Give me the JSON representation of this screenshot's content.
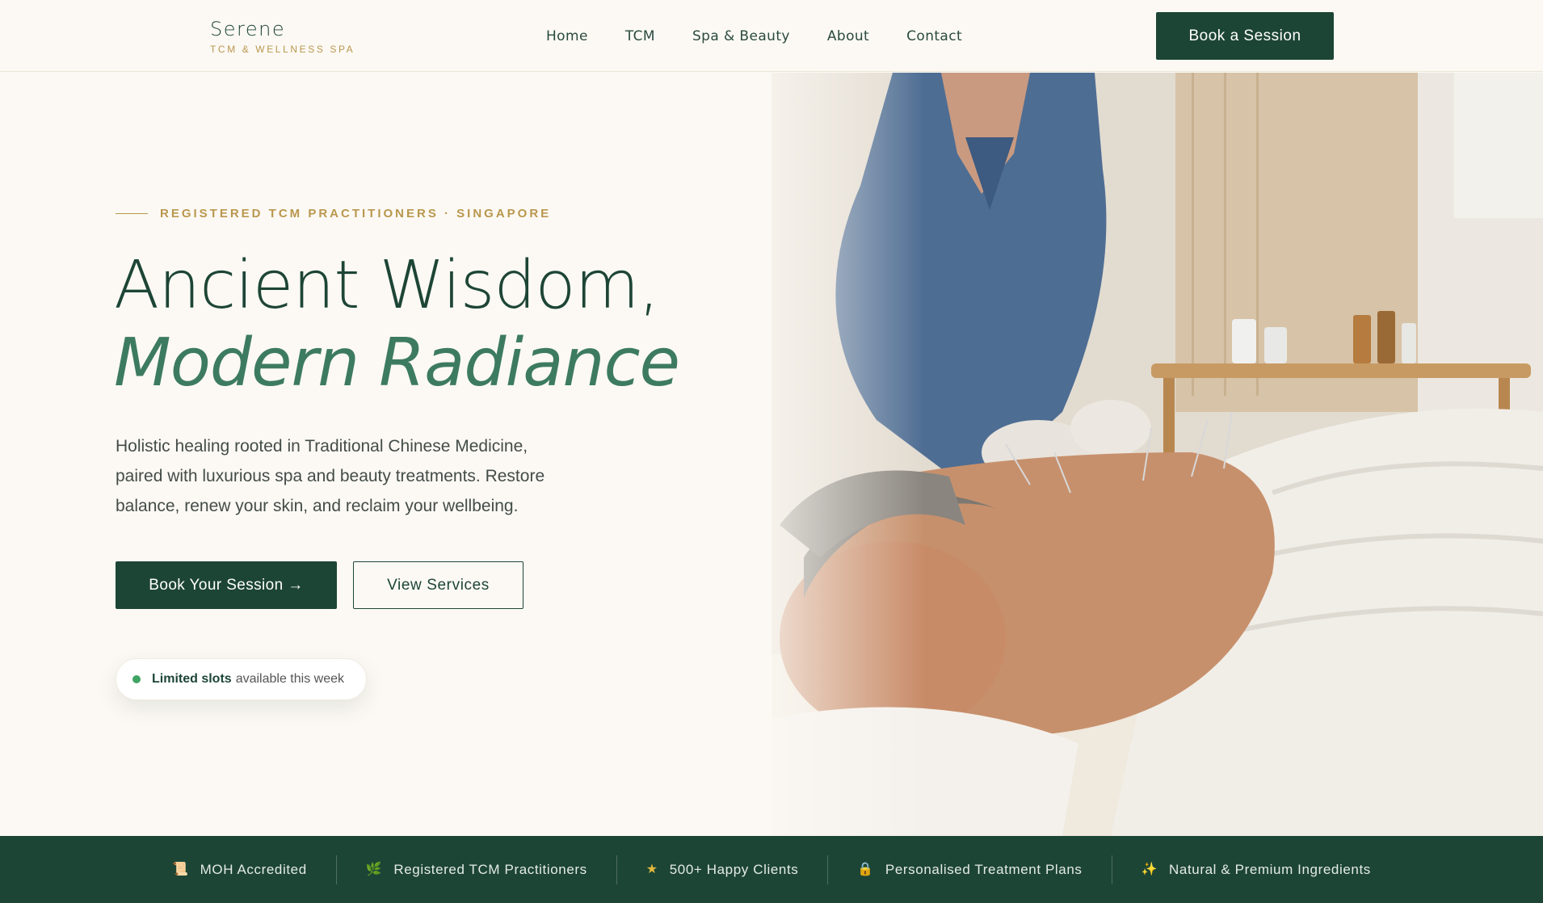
{
  "brand": {
    "name": "Serene",
    "tagline": "TCM & WELLNESS SPA"
  },
  "nav": {
    "items": [
      "Home",
      "TCM",
      "Spa & Beauty",
      "About",
      "Contact"
    ],
    "cta": "Book a Session"
  },
  "hero": {
    "eyebrow": "REGISTERED TCM PRACTITIONERS · SINGAPORE",
    "headline_line1": "Ancient Wisdom,",
    "headline_line2": "Modern Radiance",
    "lead_line1": "Holistic healing rooted in Traditional Chinese Medicine,",
    "lead_line2": "paired with luxurious spa and beauty treatments. Restore",
    "lead_line3": "balance, renew your skin, and reclaim your wellbeing.",
    "primary_cta": "Book Your Session →",
    "secondary_cta": "View Services",
    "slots_strong": "Limited slots",
    "slots_rest": "available this week"
  },
  "trust": [
    {
      "icon": "scroll-icon",
      "glyph": "📜",
      "label": "MOH Accredited"
    },
    {
      "icon": "herb-icon",
      "glyph": "🌿",
      "label": "Registered TCM Practitioners"
    },
    {
      "icon": "star-icon",
      "glyph": "★",
      "label": "500+ Happy Clients"
    },
    {
      "icon": "lock-icon",
      "glyph": "🔒",
      "label": "Personalised Treatment Plans"
    },
    {
      "icon": "sparkle-icon",
      "glyph": "✨",
      "label": "Natural & Premium Ingredients"
    }
  ],
  "colors": {
    "primary": "#1d4536",
    "accent_gold": "#b9974e",
    "italic_green": "#3d7b60",
    "background": "#fcf9f4",
    "status_dot": "#3fa463"
  }
}
